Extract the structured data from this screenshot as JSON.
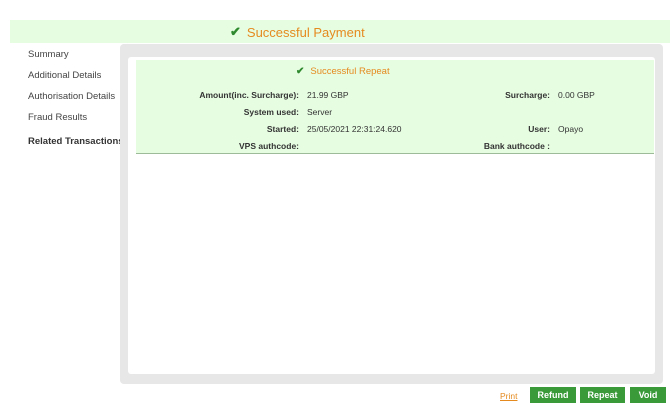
{
  "header": {
    "title": "Successful Payment",
    "icon": "checkmark-icon"
  },
  "sidebar": {
    "items": [
      {
        "label": "Summary"
      },
      {
        "label": "Additional Details"
      },
      {
        "label": "Authorisation Details"
      },
      {
        "label": "Fraud Results"
      },
      {
        "label": "Related Transactions"
      }
    ]
  },
  "details": {
    "title": "Successful Repeat",
    "amount_label": "Amount(inc. Surcharge):",
    "amount_value": "21.99 GBP",
    "surcharge_label": "Surcharge:",
    "surcharge_value": "0.00 GBP",
    "system_label": "System used:",
    "system_value": "Server",
    "started_label": "Started:",
    "started_value": "25/05/2021 22:31:24.620",
    "user_label": "User:",
    "user_value": "Opayo",
    "vps_label": "VPS authcode:",
    "vps_value": "",
    "bank_label": "Bank authcode :",
    "bank_value": ""
  },
  "footer": {
    "print_label": "Print",
    "refund_label": "Refund",
    "repeat_label": "Repeat",
    "void_label": "Void"
  },
  "colors": {
    "accent_orange": "#e58a1f",
    "success_green": "#3a9a3a",
    "highlight_green": "#e6fde1"
  }
}
